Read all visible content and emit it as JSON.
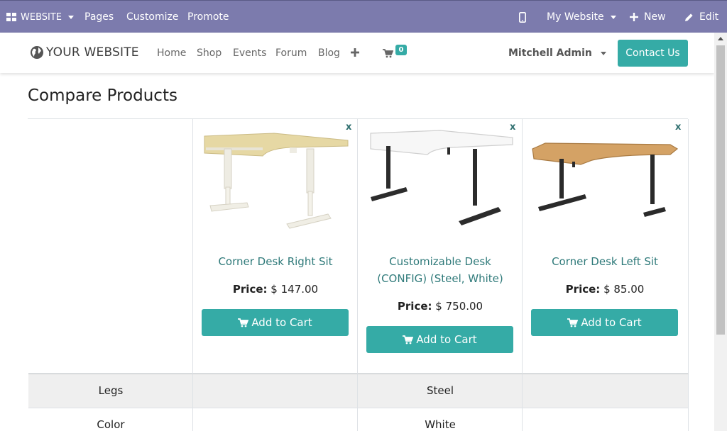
{
  "adminbar": {
    "website_menu": "WEBSITE",
    "pages": "Pages",
    "customize": "Customize",
    "promote": "Promote",
    "my_website": "My Website",
    "new": "New",
    "edit": "Edit"
  },
  "header": {
    "logo_text": "YOUR WEBSITE",
    "nav": [
      "Home",
      "Shop",
      "Events",
      "Forum",
      "Blog"
    ],
    "cart_count": "0",
    "user": "Mitchell Admin",
    "contact": "Contact Us"
  },
  "page": {
    "title": "Compare Products"
  },
  "products": [
    {
      "name_lines": [
        "Corner Desk Right Sit"
      ],
      "price_label": "Price:",
      "price": "$ 147.00",
      "cart_label": "Add to Cart",
      "remove": "x"
    },
    {
      "name_lines": [
        "Customizable Desk",
        "(CONFIG) (Steel, White)"
      ],
      "price_label": "Price:",
      "price": "$ 750.00",
      "cart_label": "Add to Cart",
      "remove": "x"
    },
    {
      "name_lines": [
        "Corner Desk Left Sit"
      ],
      "price_label": "Price:",
      "price": "$ 85.00",
      "cart_label": "Add to Cart",
      "remove": "x"
    }
  ],
  "attributes": [
    {
      "label": "Legs",
      "values": [
        "",
        "Steel",
        ""
      ]
    },
    {
      "label": "Color",
      "values": [
        "",
        "White",
        ""
      ]
    }
  ],
  "colors": {
    "adminbar": "#7c7bad",
    "accent": "#35aba6",
    "product_link": "#2f7a7a"
  }
}
